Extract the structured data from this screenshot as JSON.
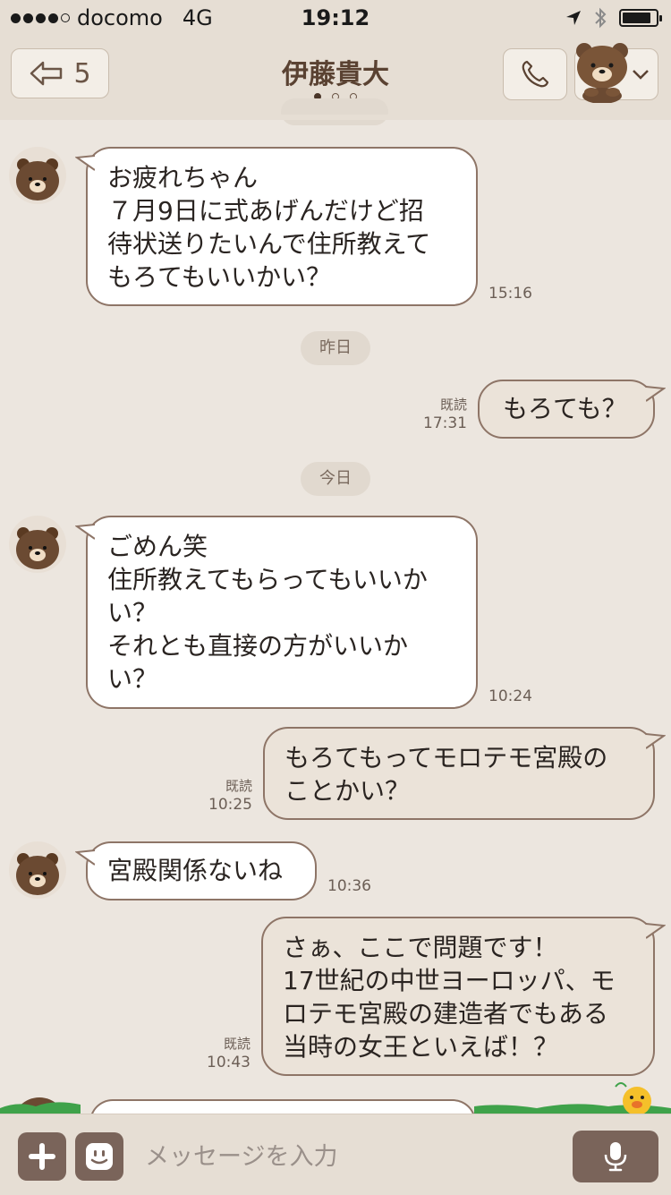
{
  "status_bar": {
    "carrier": "docomo",
    "network": "4G",
    "time": "19:12",
    "battery_level": 0.85
  },
  "header": {
    "back_count": "5",
    "title": "伊藤貴大",
    "page_dots": 3,
    "active_page": 1
  },
  "dates": {
    "yesterday": "昨日",
    "today": "今日"
  },
  "messages": [
    {
      "side": "in",
      "text": "お疲れちゃん\n７月9日に式あげんだけど招\n待状送りたいんで住所教えて\nもろてもいいかい？",
      "time": "15:16"
    },
    {
      "side": "out",
      "text": "もろても？",
      "read": "既読",
      "time": "17:31"
    },
    {
      "side": "in",
      "text": "ごめん笑\n住所教えてもらってもいいか\nい？\nそれとも直接の方がいいか\nい？",
      "time": "10:24"
    },
    {
      "side": "out",
      "text": "もろてもってモロテモ宮殿の\nことかい？",
      "read": "既読",
      "time": "10:25"
    },
    {
      "side": "in",
      "text": "宮殿関係ないね",
      "time": "10:36"
    },
    {
      "side": "out",
      "text": "さぁ、ここで問題です！\n17世紀の中世ヨーロッパ、モ\nロテモ宮殿の建造者でもある\n当時の女王といえば！？",
      "read": "既読",
      "time": "10:43"
    }
  ],
  "input": {
    "placeholder": "メッセージを入力"
  },
  "colors": {
    "background": "#ece6df",
    "header": "#e6ded4",
    "bubble_border": "#8e7567",
    "button": "#7a645a"
  },
  "icons": [
    "back-arrow-icon",
    "phone-icon",
    "bear-avatar-icon",
    "chevron-down-icon",
    "plus-icon",
    "emoji-icon",
    "microphone-icon"
  ]
}
